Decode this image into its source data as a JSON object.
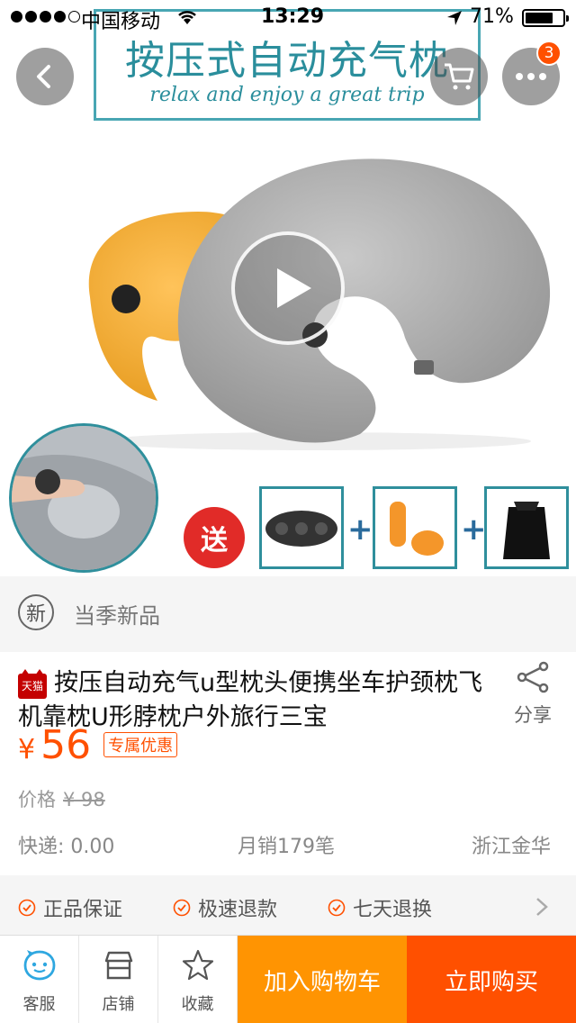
{
  "status_bar": {
    "carrier": "中国移动",
    "time": "13:29",
    "battery": "71%",
    "signal_bars_filled": 4,
    "signal_bars_total": 5
  },
  "hero": {
    "banner_title": "按压式自动充气枕",
    "banner_subtitle": "relax and enjoy a great trip",
    "gift_label": "送",
    "cart_badge_count": "3"
  },
  "product": {
    "new_label": "新",
    "new_text": "当季新品",
    "store_badge": "天猫",
    "title": "按压自动充气u型枕头便携坐车护颈枕飞机靠枕U形脖枕户外旅行三宝",
    "share_label": "分享",
    "currency": "¥",
    "price": "56",
    "promo_tag": "专属优惠",
    "original_price_label": "价格",
    "original_price": "¥ 98",
    "shipping": "快递: 0.00",
    "monthly_sales": "月销179笔",
    "location": "浙江金华"
  },
  "guarantees": [
    "正品保证",
    "极速退款",
    "七天退换"
  ],
  "bottom_bar": {
    "service_label": "客服",
    "shop_label": "店铺",
    "favorite_label": "收藏",
    "add_to_cart_label": "加入购物车",
    "buy_now_label": "立即购买"
  },
  "colors": {
    "accent": "#ff5000",
    "cart_button": "#ff9402",
    "banner_teal": "#2a8e9c"
  }
}
